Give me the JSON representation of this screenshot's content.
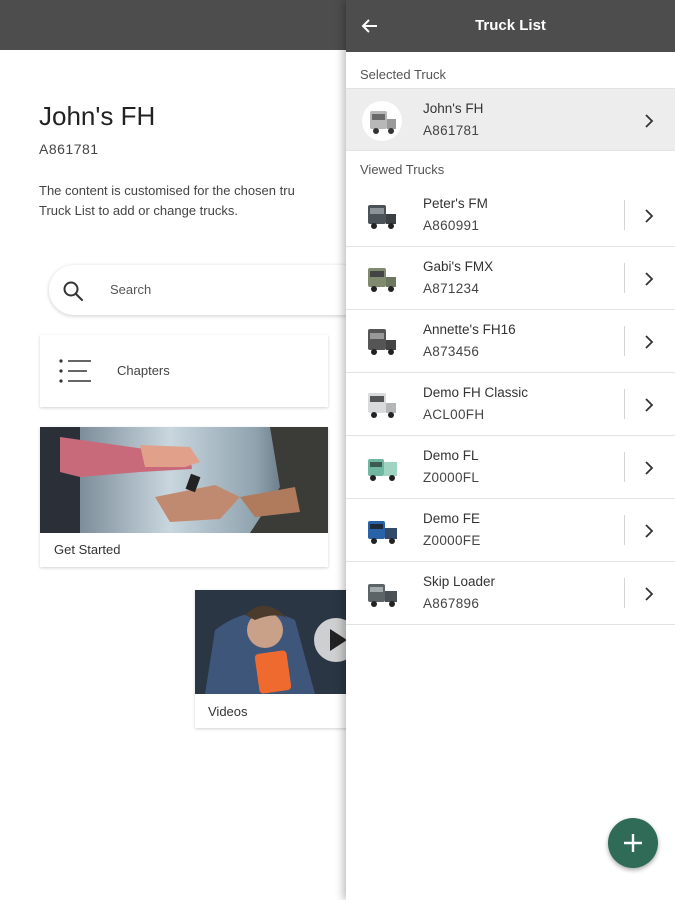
{
  "background": {
    "truck_name": "John's FH",
    "truck_code": "A861781",
    "intro_line1": "The content is customised for the chosen tru",
    "intro_line2": "Truck List to add or change trucks.",
    "search_placeholder": "Search",
    "chapters_label": "Chapters",
    "get_started_label": "Get Started",
    "videos_label": "Videos"
  },
  "panel": {
    "title": "Truck List",
    "selected_section_label": "Selected Truck",
    "viewed_section_label": "Viewed Trucks",
    "selected": {
      "name": "John's FH",
      "code": "A861781",
      "icon": "truck-thumbnail"
    },
    "viewed": [
      {
        "name": "Peter's FM",
        "code": "A860991",
        "icon": "truck-thumbnail"
      },
      {
        "name": "Gabi's FMX",
        "code": "A871234",
        "icon": "truck-thumbnail"
      },
      {
        "name": "Annette's FH16",
        "code": "A873456",
        "icon": "truck-thumbnail"
      },
      {
        "name": "Demo FH Classic",
        "code": "ACL00FH",
        "icon": "truck-thumbnail"
      },
      {
        "name": "Demo FL",
        "code": "Z0000FL",
        "icon": "truck-thumbnail"
      },
      {
        "name": "Demo FE",
        "code": "Z0000FE",
        "icon": "truck-thumbnail"
      },
      {
        "name": "Skip Loader",
        "code": "A867896",
        "icon": "truck-thumbnail"
      }
    ]
  },
  "colors": {
    "header": "#4d4d4d",
    "fab": "#2f6b57",
    "selected_row": "#ededed"
  }
}
